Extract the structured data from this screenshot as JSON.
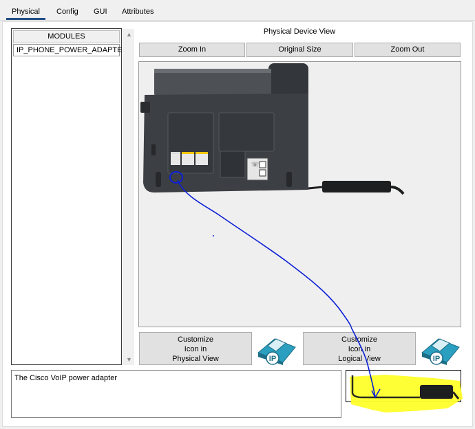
{
  "tabs": [
    {
      "label": "Physical",
      "active": true
    },
    {
      "label": "Config",
      "active": false
    },
    {
      "label": "GUI",
      "active": false
    },
    {
      "label": "Attributes",
      "active": false
    }
  ],
  "modules": {
    "header": "MODULES",
    "items": [
      "IP_PHONE_POWER_ADAPTER"
    ]
  },
  "view": {
    "title": "Physical Device View",
    "zoom_in": "Zoom In",
    "original_size": "Original Size",
    "zoom_out": "Zoom Out"
  },
  "customize_physical": [
    "Customize",
    "Icon in",
    "Physical View"
  ],
  "customize_logical": [
    "Customize",
    "Icon in",
    "Logical View"
  ],
  "ip_icon_label": "IP",
  "description": "The Cisco VoIP power adapter",
  "colors": {
    "tab_accent": "#1f4e86",
    "annotation_blue": "#0a1fd6",
    "highlight_yellow": "#ffff2a",
    "phone_body": "#3c3f44",
    "ip_phone_teal": "#2b9fc0"
  }
}
